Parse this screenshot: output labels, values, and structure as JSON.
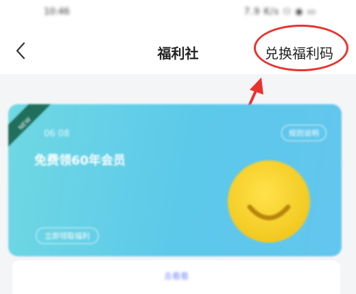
{
  "status_bar": {
    "time": "10:46",
    "icons": "7.9 K/s ⚇ ◉ ▭"
  },
  "nav": {
    "back_icon": "chevron-left-icon",
    "title": "福利社",
    "redeem_label": "兑换福利码"
  },
  "annotation": {
    "color": "#e8322d"
  },
  "card": {
    "ribbon_text": "NEW",
    "subtitle": "06 08",
    "title": "免费领60年会员",
    "tag": "规则说明",
    "action": "立即领取福利",
    "accent_color": "#5cc8ea"
  },
  "bottom": {
    "link_text": "去看看"
  }
}
